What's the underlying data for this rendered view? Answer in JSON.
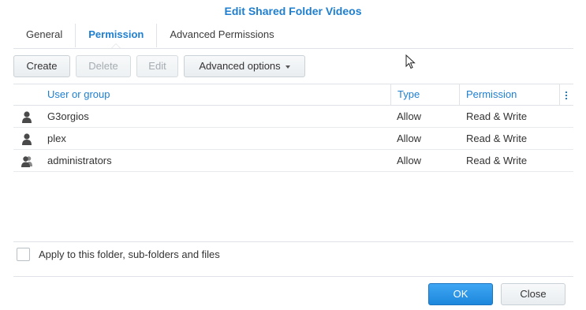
{
  "window": {
    "title": "Edit Shared Folder Videos"
  },
  "tabs": [
    {
      "label": "General",
      "active": false
    },
    {
      "label": "Permission",
      "active": true
    },
    {
      "label": "Advanced Permissions",
      "active": false
    }
  ],
  "toolbar": {
    "create_label": "Create",
    "delete_label": "Delete",
    "edit_label": "Edit",
    "advanced_label": "Advanced options"
  },
  "grid": {
    "columns": [
      "User or group",
      "Type",
      "Permission"
    ],
    "rows": [
      {
        "icon": "user-icon",
        "name": "G3orgios",
        "type": "Allow",
        "permission": "Read & Write"
      },
      {
        "icon": "user-icon",
        "name": "plex",
        "type": "Allow",
        "permission": "Read & Write"
      },
      {
        "icon": "group-icon",
        "name": "administrators",
        "type": "Allow",
        "permission": "Read & Write"
      }
    ]
  },
  "apply": {
    "label": "Apply to this folder, sub-folders and files",
    "checked": false
  },
  "footer": {
    "ok_label": "OK",
    "close_label": "Close"
  },
  "colors": {
    "accent": "#1e7fd0",
    "primary_button": "#2a95e8",
    "border": "#dfe3e7"
  }
}
